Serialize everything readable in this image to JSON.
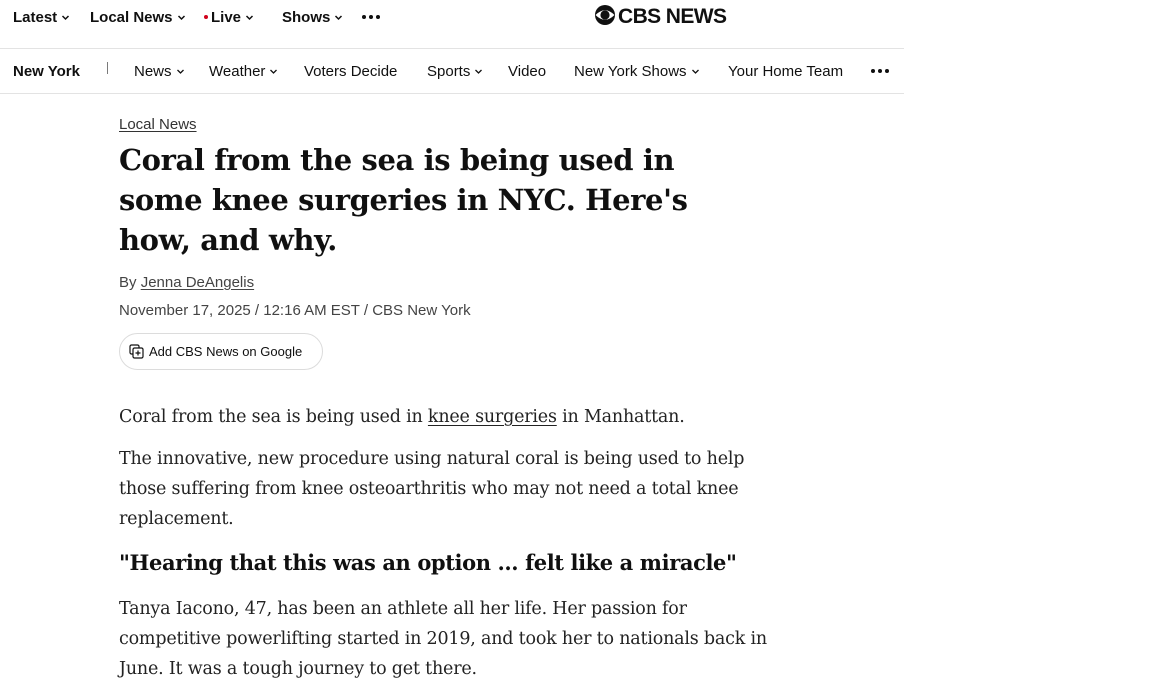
{
  "top_nav": {
    "latest": "Latest",
    "local_news": "Local News",
    "live": "Live",
    "shows": "Shows"
  },
  "brand": {
    "logo_text": "CBS NEWS"
  },
  "section_nav": {
    "brand": "New York",
    "items": [
      "News",
      "Weather",
      "Voters Decide",
      "Sports",
      "Video",
      "New York Shows",
      "Your Home Team"
    ]
  },
  "article": {
    "kicker": "Local News",
    "headline": "Coral from the sea is being used in some knee surgeries in NYC. Here's how, and why.",
    "byline_prefix": "By",
    "author": "Jenna DeAngelis",
    "dateline": "November 17, 2025 / 12:16 AM EST / CBS New York",
    "google_button": "Add CBS News on Google",
    "p1_before": "Coral from the sea is being used in ",
    "p1_link": "knee surgeries",
    "p1_after": " in Manhattan.",
    "p2": "The innovative, new procedure using natural coral is being used to help those suffering from knee osteoarthritis who may not need a total knee replacement.",
    "subhead": "\"Hearing that this was an option ... felt like a miracle\"",
    "p3": "Tanya Iacono, 47, has been an athlete all her life. Her passion for competitive powerlifting started in 2019, and took her to nationals back in June. It was a tough journey to get there."
  },
  "colors": {
    "text": "#101010",
    "live_dot": "#d0021b",
    "divider": "#e3e3e3"
  }
}
